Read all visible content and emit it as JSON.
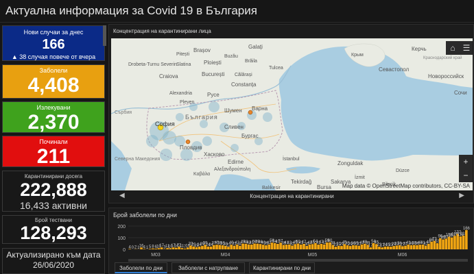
{
  "header": {
    "title": "Актуална информация за Covid 19 в България"
  },
  "cards": {
    "new_cases": {
      "label": "Нови случаи за днес",
      "value": "166",
      "sub": "▲ 38 случая повече от вчера"
    },
    "infected": {
      "label": "Заболели",
      "value": "4,408"
    },
    "recovered": {
      "label": "Излекувани",
      "value": "2,370"
    },
    "deaths": {
      "label": "Починали",
      "value": "211"
    },
    "quarantined": {
      "label": "Карантинирани досега",
      "value": "222,888",
      "sub": "16,433 активни"
    },
    "tested": {
      "label": "Брой тествани",
      "value": "128,293"
    },
    "updated": {
      "label": "Актуализирано към дата",
      "date": "26/06/2020"
    }
  },
  "map_panel": {
    "title": "Концентрация на карантинирани лица",
    "footer_caption": "Концентрация на карантинирани",
    "attribution": "Map data © OpenStreetMap contributors, CC-BY-SA",
    "home_icon": "home-icon",
    "list_icon": "layer-list-icon",
    "zoom_in": "+",
    "zoom_out": "−",
    "prev": "◀",
    "next": "▶",
    "places": {
      "bulgaria": "България",
      "sofia": "София",
      "plovdiv": "Пловдив",
      "varna": "Варна",
      "burgas": "Бургас",
      "shumen": "Шумен",
      "sliven": "Сливен",
      "ruse": "Русе",
      "haskovo": "Хасково",
      "edirne": "Edirne",
      "bucuresti": "București",
      "constanta": "Constanța",
      "brasov": "Brașov",
      "galati": "Galați",
      "craiova": "Craiova",
      "ploiesti": "Ploiești",
      "sevastopol": "Севастопол",
      "kerch": "Керчь",
      "novorossiysk": "Новороссийск",
      "krasnodar": "Краснодарский край",
      "sochi": "Сочи",
      "tekirdag": "Tekirdağ",
      "sakarya": "Sakarya",
      "bursa": "Bursa",
      "zonguldak": "Zonguldak",
      "macedonia": "Северна Македония",
      "serbia": "Сърбия",
      "alexandria": "Alexandria",
      "slatina": "Slatina",
      "buzau": "Buzău",
      "tulcea": "Tulcea",
      "drobeta": "Drobeta-Turnu Severin",
      "pitesti": "Pitești",
      "calarasi": "Călărași",
      "braila": "Brăila",
      "krym": "Крым",
      "izmit": "İzmit",
      "balikesir": "Balıkesir",
      "bilecik": "Bilecik",
      "kozlu": "Düzce",
      "kavala": "Καβάλα",
      "alexandroupoli": "Αλεξανδρούπολη",
      "constantinople": "İstanbul",
      "ploesti2": "Pleven"
    }
  },
  "chart_panel": {
    "title": "Брой заболели по дни",
    "tabs": [
      "Заболели по дни",
      "Заболели с натрупване",
      "Карантинирани по дни"
    ]
  },
  "chart_data": {
    "type": "bar",
    "title": "Брой заболели по дни",
    "xlabel": "",
    "ylabel": "",
    "ylim": [
      0,
      200
    ],
    "yticks": [
      0,
      100,
      200
    ],
    "month_ticks": [
      "M03",
      "M04",
      "M05",
      "M06"
    ],
    "month_start_index": [
      0,
      24,
      54,
      85
    ],
    "color": "#f0a512",
    "values": [
      4,
      0,
      2,
      1,
      16,
      4,
      1,
      5,
      8,
      6,
      10,
      17,
      3,
      11,
      10,
      17,
      14,
      22,
      11,
      7,
      16,
      33,
      25,
      19,
      24,
      29,
      39,
      24,
      24,
      37,
      40,
      38,
      35,
      30,
      22,
      40,
      31,
      42,
      30,
      49,
      48,
      42,
      41,
      50,
      49,
      46,
      40,
      35,
      42,
      58,
      54,
      47,
      57,
      38,
      41,
      42,
      32,
      45,
      50,
      41,
      47,
      30,
      42,
      45,
      54,
      41,
      47,
      42,
      59,
      60,
      38,
      23,
      31,
      29,
      45,
      35,
      29,
      36,
      35,
      31,
      42,
      48,
      39,
      17,
      54,
      45,
      23,
      17,
      24,
      25,
      23,
      29,
      33,
      36,
      27,
      31,
      41,
      36,
      38,
      36,
      40,
      41,
      32,
      48,
      66,
      73,
      53,
      96,
      85,
      92,
      108,
      102,
      116,
      132,
      111,
      118,
      166
    ]
  }
}
